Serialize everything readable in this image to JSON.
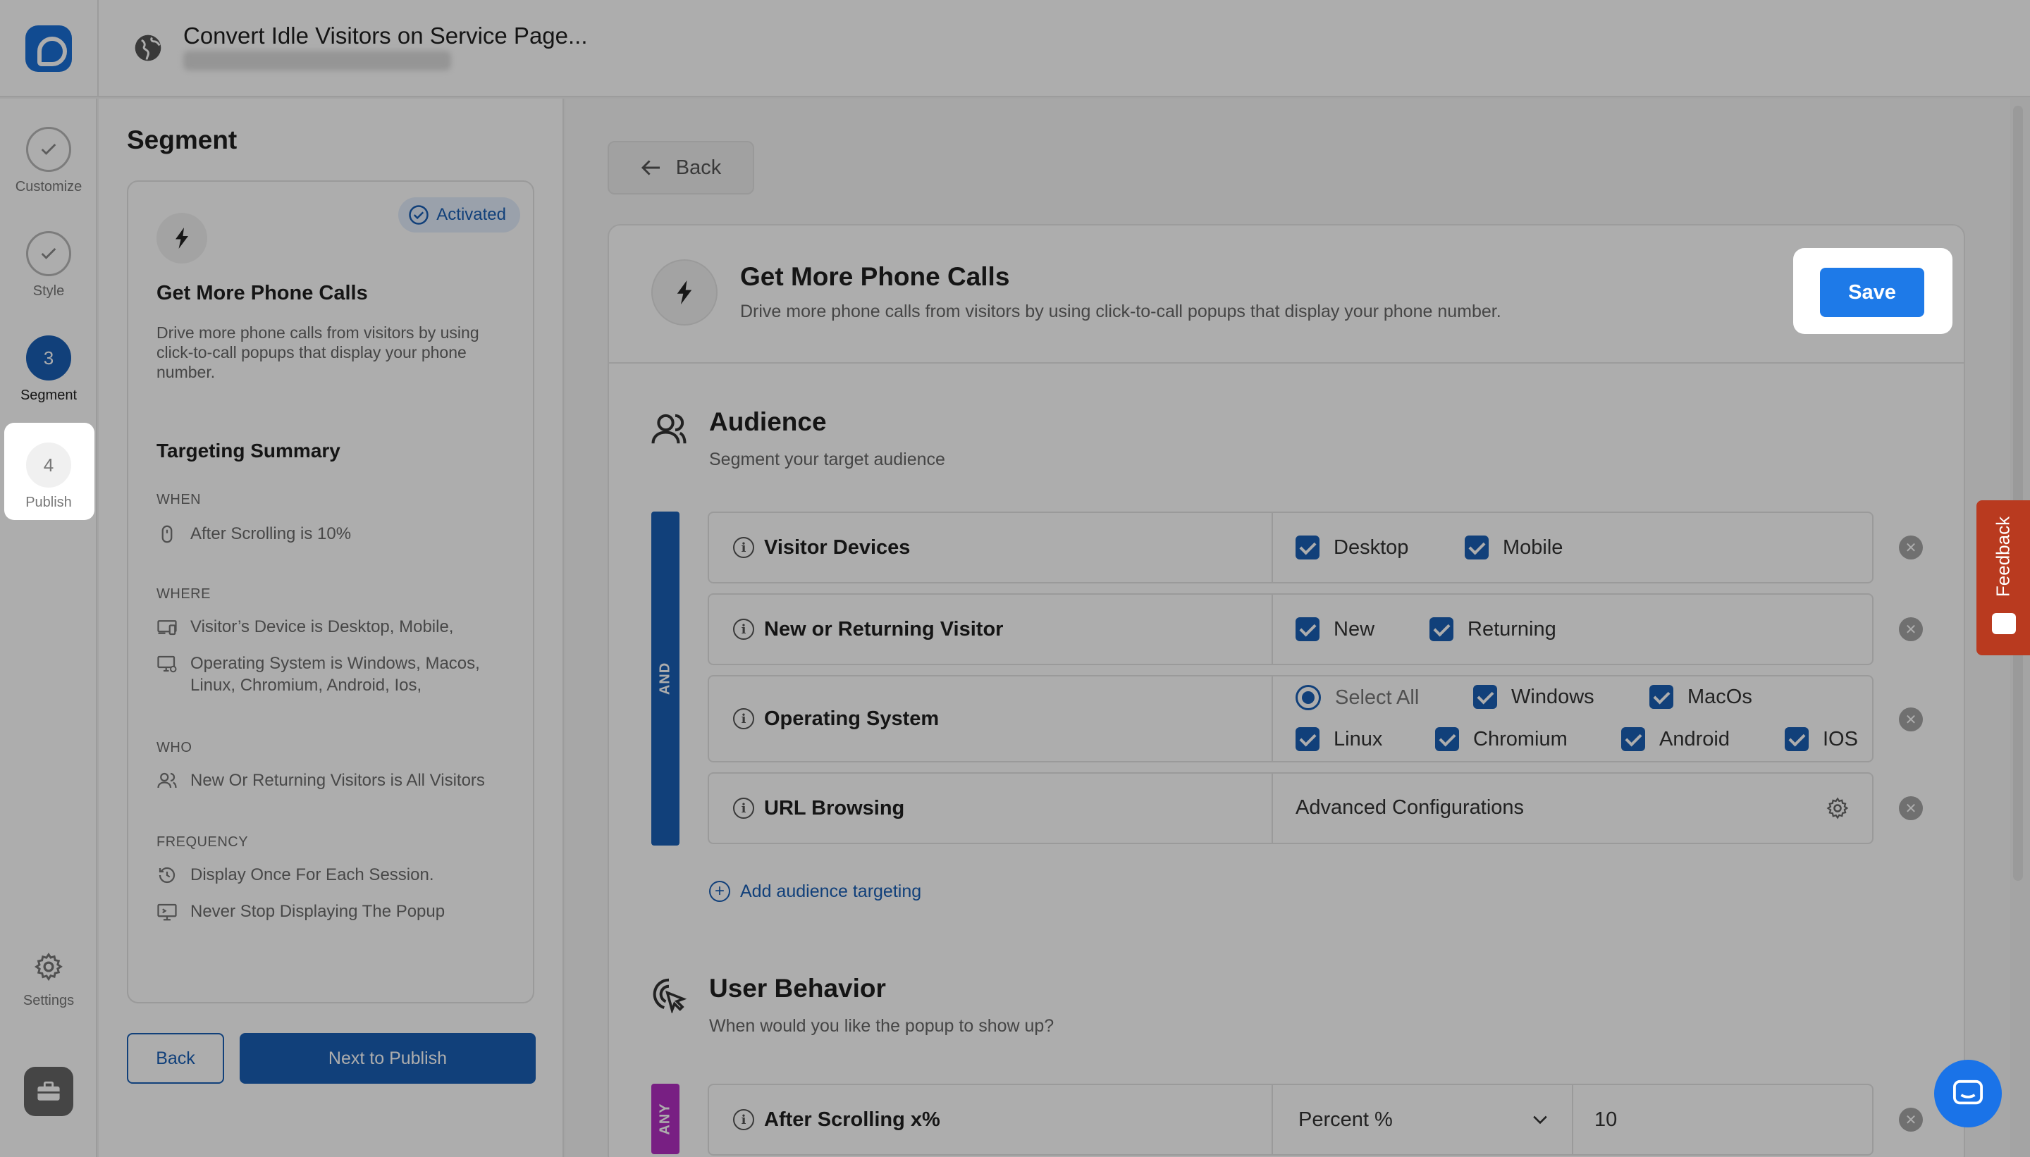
{
  "header": {
    "logo_icon": "logo-icon",
    "globe_icon": "globe-icon",
    "title": "Convert Idle Visitors on Service Page..."
  },
  "steps": [
    {
      "label": "Customize",
      "state": "done",
      "icon": "check-icon"
    },
    {
      "label": "Style",
      "state": "done",
      "icon": "check-icon"
    },
    {
      "label": "Segment",
      "number": "3",
      "state": "active"
    },
    {
      "label": "Publish",
      "number": "4",
      "state": "pending"
    }
  ],
  "rail_settings": {
    "label": "Settings",
    "icon": "gear-icon"
  },
  "panel": {
    "title": "Segment",
    "card": {
      "badge": "Activated",
      "heading": "Get More Phone Calls",
      "description": "Drive more phone calls from visitors by using click-to-call popups that display your phone number."
    },
    "summary_title": "Targeting Summary",
    "groups": [
      {
        "label": "WHEN",
        "items": [
          {
            "icon": "mouse-icon",
            "text": "After Scrolling is 10%"
          }
        ]
      },
      {
        "label": "WHERE",
        "items": [
          {
            "icon": "devices-icon",
            "text": "Visitor’s Device is Desktop, Mobile,"
          },
          {
            "icon": "monitor-icon",
            "text": "Operating System is Windows, Macos, Linux, Chromium, Android, Ios,"
          }
        ]
      },
      {
        "label": "WHO",
        "items": [
          {
            "icon": "users-icon",
            "text": "New Or Returning Visitors is All Visitors"
          }
        ]
      },
      {
        "label": "FREQUENCY",
        "items": [
          {
            "icon": "history-icon",
            "text": "Display Once For Each Session."
          },
          {
            "icon": "screen-icon",
            "text": "Never Stop Displaying The Popup"
          }
        ]
      }
    ],
    "back_label": "Back",
    "next_label": "Next to Publish"
  },
  "main": {
    "back_label": "Back",
    "goal": {
      "title": "Get More Phone Calls",
      "description": "Drive more phone calls from visitors by using click-to-call popups that display your phone number.",
      "save_label": "Save"
    },
    "audience": {
      "title": "Audience",
      "subtitle": "Segment your target audience",
      "operator": "AND",
      "rules": [
        {
          "name": "Visitor Devices",
          "options": [
            {
              "label": "Desktop",
              "checked": true
            },
            {
              "label": "Mobile",
              "checked": true
            }
          ]
        },
        {
          "name": "New or Returning Visitor",
          "options": [
            {
              "label": "New",
              "checked": true
            },
            {
              "label": "Returning",
              "checked": true
            }
          ]
        },
        {
          "name": "Operating System",
          "options": [
            {
              "label": "Select All",
              "type": "radio"
            },
            {
              "label": "Windows",
              "checked": true
            },
            {
              "label": "MacOs",
              "checked": true
            },
            {
              "label": "Linux",
              "checked": true
            },
            {
              "label": "Chromium",
              "checked": true
            },
            {
              "label": "Android",
              "checked": true
            },
            {
              "label": "IOS",
              "checked": true
            }
          ]
        },
        {
          "name": "URL Browsing",
          "value": "Advanced Configurations"
        }
      ],
      "add_label": "Add audience targeting"
    },
    "behavior": {
      "title": "User Behavior",
      "subtitle": "When would you like the popup to show up?",
      "operator": "ANY",
      "rule": {
        "name": "After Scrolling x%",
        "unit": "Percent %",
        "value": "10"
      }
    }
  },
  "feedback_label": "Feedback",
  "colors": {
    "primary": "#1a5fb4",
    "save": "#1e7ae8",
    "any": "#b12fc2",
    "feedback": "#b93a1f"
  }
}
